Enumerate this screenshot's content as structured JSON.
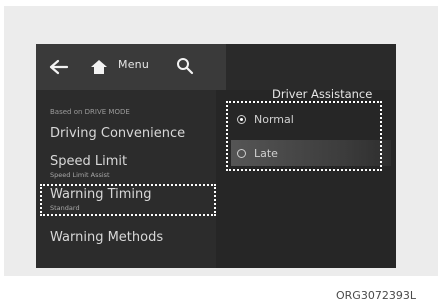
{
  "topbar": {
    "back_icon": "back-arrow-icon",
    "home_icon": "home-icon",
    "menu_label": "Menu",
    "search_icon": "search-icon"
  },
  "left_menu": {
    "caption": "Based on DRIVE MODE",
    "items": [
      {
        "label": "Driving Convenience",
        "sub": ""
      },
      {
        "label": "Speed Limit",
        "sub": "Speed Limit Assist"
      },
      {
        "label": "Warning Timing",
        "sub": "Standard"
      },
      {
        "label": "Warning Methods",
        "sub": ""
      }
    ]
  },
  "right_panel": {
    "title": "Driver Assistance",
    "options": [
      {
        "label": "Normal",
        "selected": true
      },
      {
        "label": "Late",
        "selected": false
      }
    ]
  },
  "figure_code": "ORG3072393L",
  "colors": {
    "screen_bg": "#2c2c2c",
    "topbar_bg": "#3a3a3a",
    "highlight_box": "#ffffff"
  }
}
